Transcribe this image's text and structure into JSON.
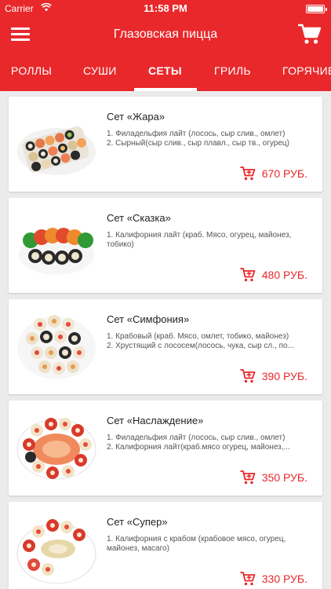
{
  "status_bar": {
    "carrier": "Carrier",
    "time": "11:58 PM"
  },
  "nav": {
    "title": "Глазовская пицца"
  },
  "tabs": [
    {
      "label": "РОЛЛЫ",
      "active": false
    },
    {
      "label": "СУШИ",
      "active": false
    },
    {
      "label": "СЕТЫ",
      "active": true
    },
    {
      "label": "ГРИЛЬ",
      "active": false
    },
    {
      "label": "ГОРЯЧИЕ",
      "active": false
    }
  ],
  "products": [
    {
      "name": "Сет «Жара»",
      "description": "1. Филадельфия лайт (лосось, сыр слив., омлет)\n 2. Сырный(сыр слив., сыр плавл., сыр тв., огурец)",
      "price": "670 РУБ."
    },
    {
      "name": "Сет «Сказка»",
      "description": "1. Калифорния лайт (краб. Мясо, огурец, майонез, тобико)",
      "price": "480 РУБ."
    },
    {
      "name": "Сет «Симфония»",
      "description": "1. Крабовый (краб. Мясо, омлет, тобико, майонез)\n 2. Хрустящий с лососем(лосось, чука, сыр сл., по...",
      "price": "390 РУБ."
    },
    {
      "name": "Сет «Наслаждение»",
      "description": "1. Филадельфия лайт (лосось, сыр слив., омлет)\n 2. Калифорния лайт(краб.мясо огурец, майонез,...",
      "price": "350 РУБ."
    },
    {
      "name": "Сет «Супер»",
      "description": "1. Калифорния с крабом (крабовое мясо, огурец, майонез, масаго)",
      "price": "330 РУБ."
    }
  ],
  "colors": {
    "accent": "#e8282b",
    "background": "#ebebeb",
    "card": "#ffffff"
  }
}
